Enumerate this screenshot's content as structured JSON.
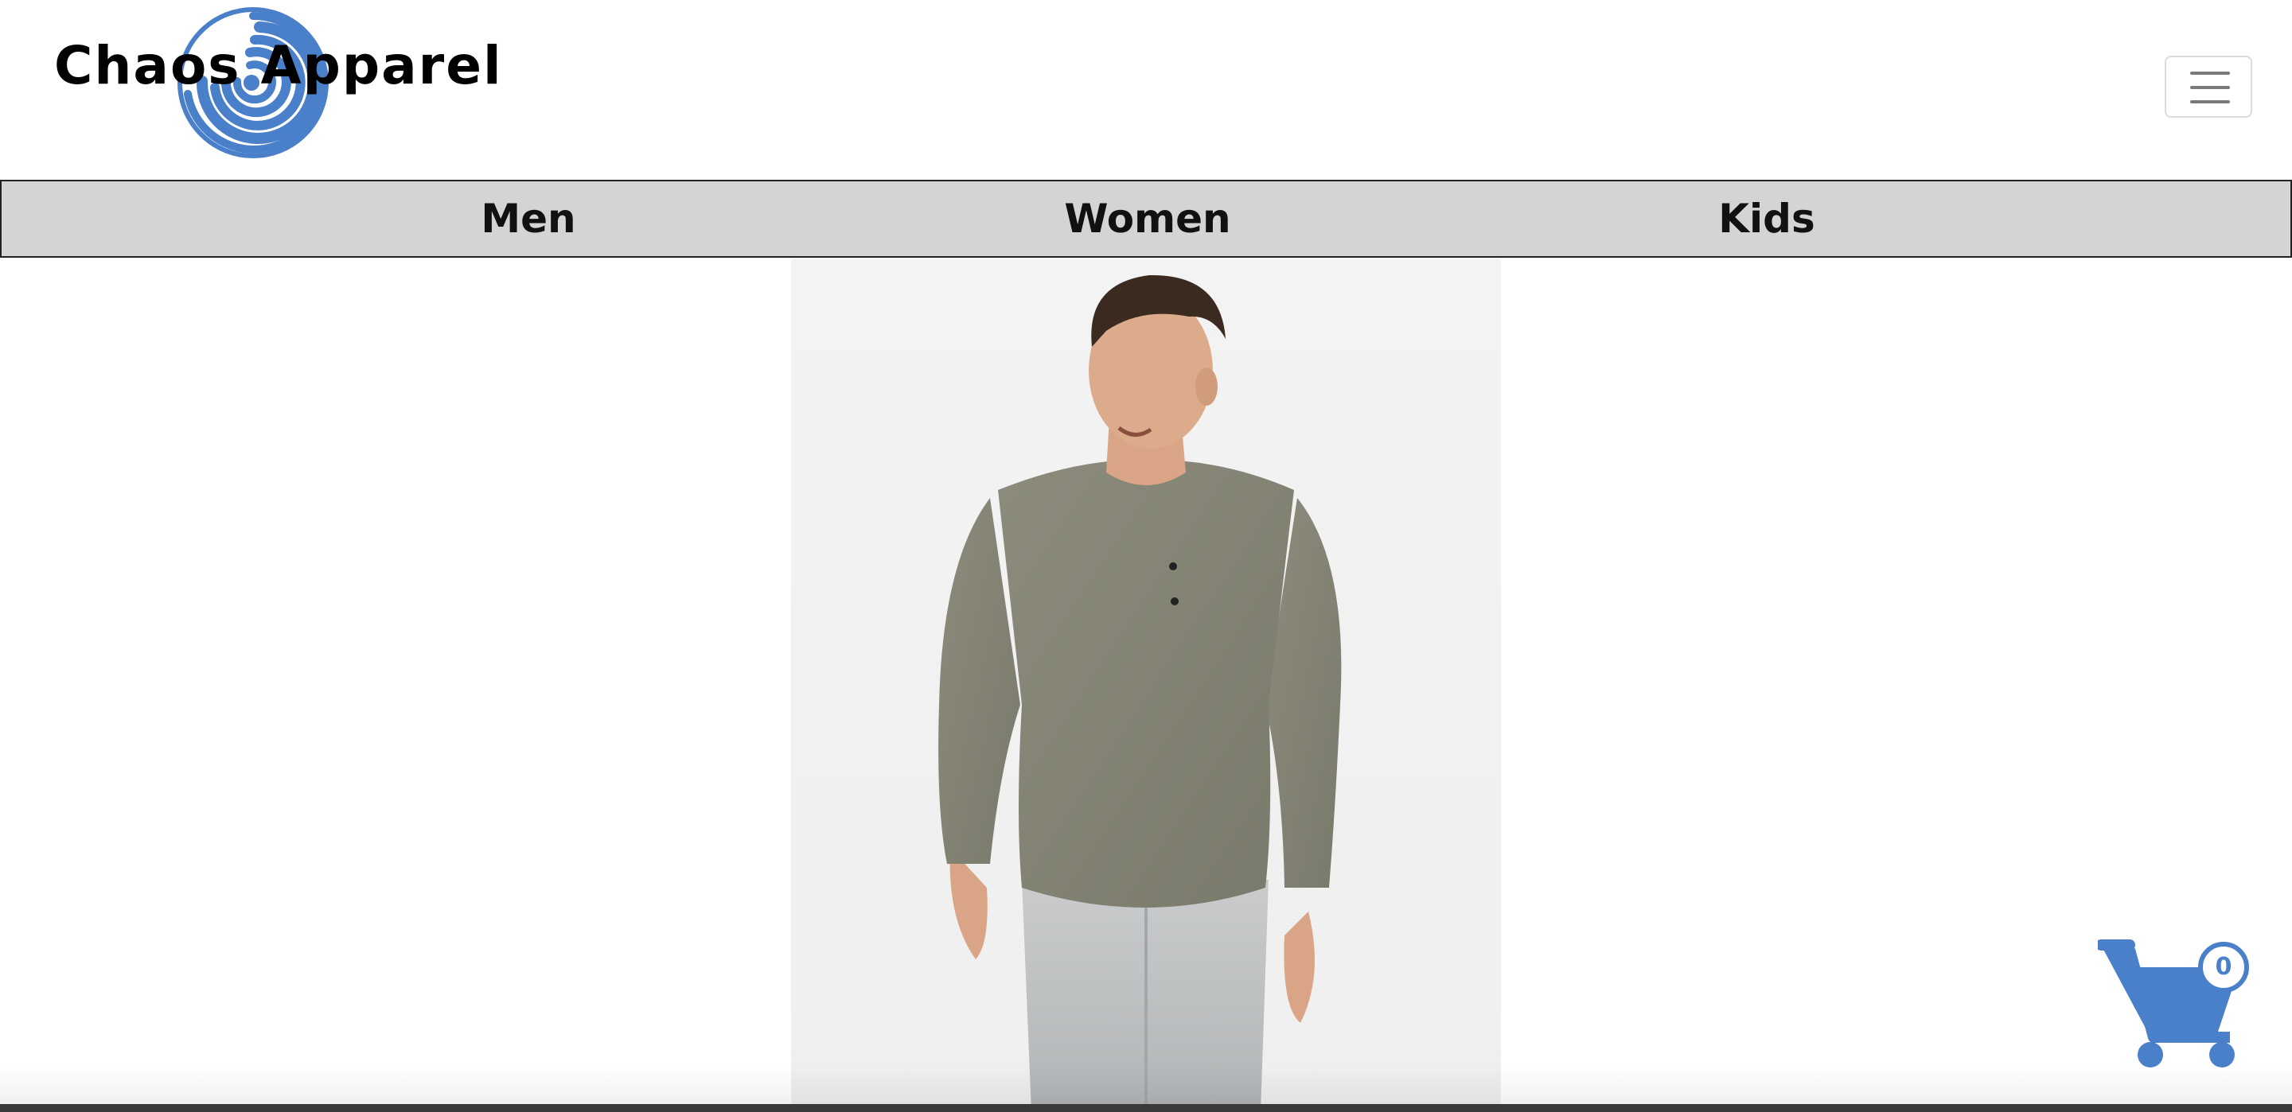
{
  "brand": {
    "name": "Chaos Apparel",
    "logo_color": "#4a7fc9"
  },
  "header": {
    "menu_icon": "hamburger-menu-icon"
  },
  "categories": [
    {
      "label": "Men"
    },
    {
      "label": "Women"
    },
    {
      "label": "Kids"
    }
  ],
  "colors": {
    "nav_background": "#d4d4d4",
    "accent": "#4a7fc9",
    "text": "#111111"
  },
  "product": {
    "image_alt": "Man wearing heather green long-sleeve henley shirt and light wash jeans"
  },
  "cart": {
    "icon": "shopping-cart-icon",
    "count": "0"
  }
}
